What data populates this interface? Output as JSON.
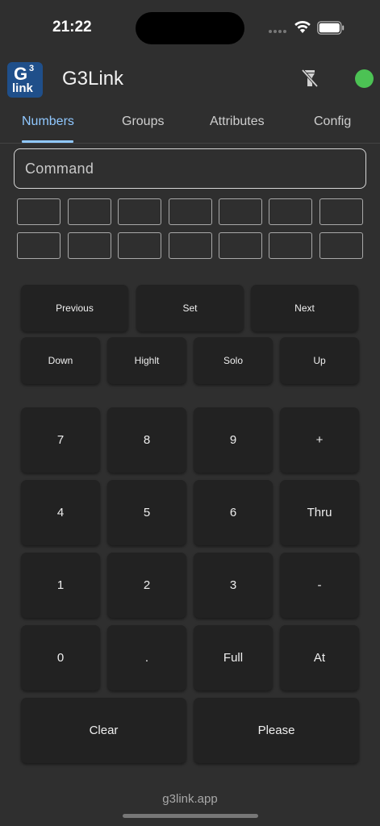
{
  "status_bar": {
    "time": "21:22"
  },
  "app": {
    "title": "G3Link",
    "logo_letter": "G",
    "logo_superscript": "3",
    "logo_word": "link",
    "connection_color": "#4cc254"
  },
  "icons": {
    "flash": "flash-off-icon",
    "status": "connection-status-icon"
  },
  "tabs": [
    {
      "label": "Numbers",
      "active": true
    },
    {
      "label": "Groups",
      "active": false
    },
    {
      "label": "Attributes",
      "active": false
    },
    {
      "label": "Config",
      "active": false
    }
  ],
  "command": {
    "placeholder": "Command",
    "value": ""
  },
  "nav_keys": {
    "previous": "Previous",
    "set": "Set",
    "next": "Next"
  },
  "mode_keys": {
    "down": "Down",
    "highlight": "Highlt",
    "solo": "Solo",
    "up": "Up"
  },
  "keypad": {
    "row1": [
      "7",
      "8",
      "9",
      "+"
    ],
    "row2": [
      "4",
      "5",
      "6",
      "Thru"
    ],
    "row3": [
      "1",
      "2",
      "3",
      "-"
    ],
    "row4": [
      "0",
      ".",
      "Full",
      "At"
    ],
    "clear": "Clear",
    "please": "Please"
  },
  "footer": {
    "text": "g3link.app"
  },
  "colors": {
    "background": "#2f2f2f",
    "key": "#222222",
    "accent": "#90c8ff"
  }
}
